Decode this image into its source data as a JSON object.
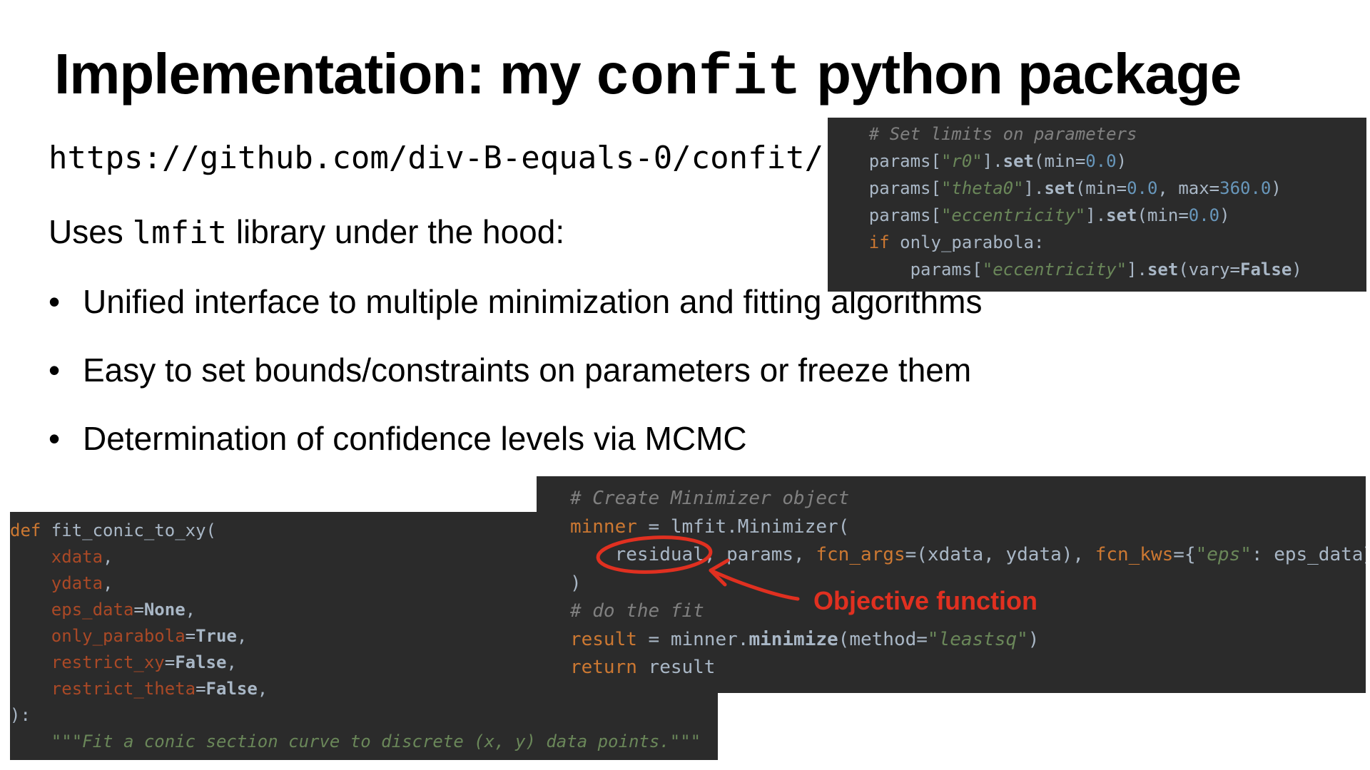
{
  "slide": {
    "title_prefix": "Implementation: my ",
    "title_code": "confit",
    "title_suffix": " python package",
    "url": "https://github.com/div-B-equals-0/confit/",
    "intro_prefix": "Uses ",
    "intro_code": "lmfit",
    "intro_suffix": " library under the hood:",
    "bullet_glyph": "•",
    "bullets": [
      "Unified interface to multiple minimization and fitting algorithms",
      "Easy to set bounds/constraints on parameters or freeze them",
      "Determination of confidence levels via MCMC"
    ]
  },
  "code_params": {
    "comment": "# Set limits on parameters",
    "line1_a": "params[",
    "line1_key": "\"r0\"",
    "line1_b": "].",
    "line1_set": "set",
    "line1_c": "(min=",
    "line1_num": "0.0",
    "line1_d": ")",
    "line2_a": "params[",
    "line2_key": "\"theta0\"",
    "line2_b": "].",
    "line2_set": "set",
    "line2_c": "(min=",
    "line2_num1": "0.0",
    "line2_d": ", max=",
    "line2_num2": "360.0",
    "line2_e": ")",
    "line3_a": "params[",
    "line3_key": "\"eccentricity\"",
    "line3_b": "].",
    "line3_set": "set",
    "line3_c": "(min=",
    "line3_num": "0.0",
    "line3_d": ")",
    "line4_if": "if",
    "line4_rest": " only_parabola:",
    "line5_indent": "    ",
    "line5_a": "params[",
    "line5_key": "\"eccentricity\"",
    "line5_b": "].",
    "line5_set": "set",
    "line5_c": "(vary=",
    "line5_false": "False",
    "line5_d": ")"
  },
  "code_def": {
    "def_kw": "def",
    "fn_name": " fit_conic_to_xy(",
    "args": [
      {
        "name": "    xdata",
        "eq": "",
        "val": "",
        "end": ","
      },
      {
        "name": "    ydata",
        "eq": "",
        "val": "",
        "end": ","
      },
      {
        "name": "    eps_data",
        "eq": "=",
        "val": "None",
        "end": ","
      },
      {
        "name": "    only_parabola",
        "eq": "=",
        "val": "True",
        "end": ","
      },
      {
        "name": "    restrict_xy",
        "eq": "=",
        "val": "False",
        "end": ","
      },
      {
        "name": "    restrict_theta",
        "eq": "=",
        "val": "False",
        "end": ","
      }
    ],
    "close": "):",
    "docstring": "    \"\"\"Fit a conic section curve to discrete (x, y) data points.\"\"\""
  },
  "code_minner": {
    "comment1": "# Create Minimizer object",
    "l2_var": "minner",
    "l2_rest": " = lmfit.Minimizer(",
    "l3_indent": "    ",
    "l3_residual": "residual",
    "l3_a": ", params, ",
    "l3_kw1": "fcn_args",
    "l3_b": "=(xdata, ydata), ",
    "l3_kw2": "fcn_kws",
    "l3_c": "={",
    "l3_key": "\"eps\"",
    "l3_d": ": eps_data}",
    "l4": ")",
    "comment2": "# do the fit",
    "l6_var": "result",
    "l6_a": " = minner.",
    "l6_method": "minimize",
    "l6_b": "(method=",
    "l6_str": "\"leastsq\"",
    "l6_c": ")",
    "l7_kw": "return",
    "l7_rest": " result"
  },
  "annotation": {
    "label": "Objective function",
    "color": "#e03020"
  },
  "colors": {
    "code_bg": "#2b2b2b",
    "code_text": "#a9b7c6",
    "comment": "#808080",
    "string": "#6a8759",
    "number": "#6897bb",
    "keyword": "#cc7832"
  }
}
